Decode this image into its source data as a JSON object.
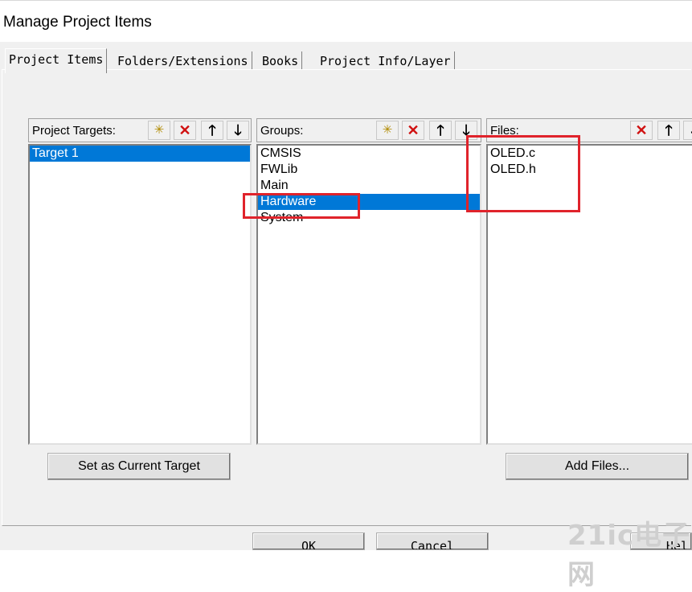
{
  "window": {
    "title": "Manage Project Items"
  },
  "tabs": [
    {
      "label": "Project Items",
      "active": true
    },
    {
      "label": "Folders/Extensions",
      "active": false
    },
    {
      "label": "Books",
      "active": false
    },
    {
      "label": "Project Info/Layer",
      "active": false
    }
  ],
  "targets": {
    "header": "Project Targets:",
    "items": [
      {
        "label": "Target 1",
        "selected": true
      }
    ],
    "button": "Set as Current Target"
  },
  "groups": {
    "header": "Groups:",
    "items": [
      {
        "label": "CMSIS",
        "selected": false
      },
      {
        "label": "FWLib",
        "selected": false
      },
      {
        "label": "Main",
        "selected": false
      },
      {
        "label": "Hardware",
        "selected": true
      },
      {
        "label": "System",
        "selected": false
      }
    ]
  },
  "files": {
    "header": "Files:",
    "items": [
      {
        "label": "OLED.c"
      },
      {
        "label": "OLED.h"
      }
    ],
    "button": "Add Files..."
  },
  "footer": {
    "ok": "OK",
    "cancel": "Cancel",
    "help": "Hel"
  },
  "watermark": "21ic电子网",
  "colors": {
    "selection": "#0078d7",
    "highlight_box": "#e0232b",
    "delete_icon": "#d01010"
  }
}
